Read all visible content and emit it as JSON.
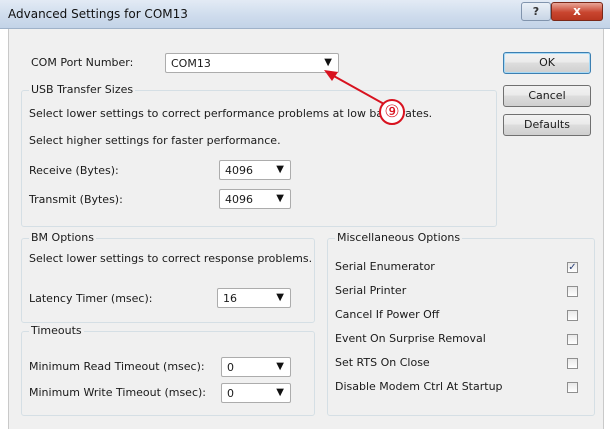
{
  "window": {
    "title": "Advanced Settings for COM13",
    "help_icon": "?",
    "close_icon": "x"
  },
  "com_port": {
    "label": "COM Port Number:",
    "value": "COM13"
  },
  "buttons": {
    "ok": "OK",
    "cancel": "Cancel",
    "defaults": "Defaults"
  },
  "usb": {
    "title": "USB Transfer Sizes",
    "hint_lower": "Select lower settings to correct performance problems at low baud rates.",
    "hint_higher": "Select higher settings for faster performance.",
    "receive_label": "Receive (Bytes):",
    "receive_value": "4096",
    "transmit_label": "Transmit (Bytes):",
    "transmit_value": "4096"
  },
  "bm": {
    "title": "BM Options",
    "hint": "Select lower settings to correct response problems.",
    "latency_label": "Latency Timer (msec):",
    "latency_value": "16"
  },
  "timeouts": {
    "title": "Timeouts",
    "read_label": "Minimum Read Timeout (msec):",
    "read_value": "0",
    "write_label": "Minimum Write Timeout (msec):",
    "write_value": "0"
  },
  "misc": {
    "title": "Miscellaneous Options",
    "options": [
      {
        "label": "Serial Enumerator",
        "checked": true
      },
      {
        "label": "Serial Printer",
        "checked": false
      },
      {
        "label": "Cancel If Power Off",
        "checked": false
      },
      {
        "label": "Event On Surprise Removal",
        "checked": false
      },
      {
        "label": "Set RTS On Close",
        "checked": false
      },
      {
        "label": "Disable Modem Ctrl At Startup",
        "checked": false
      }
    ]
  },
  "annotation": {
    "marker": "⑨",
    "color": "#d8121f"
  },
  "icons": {
    "dropdown": "caret-down-icon",
    "checkmark": "check-icon"
  }
}
